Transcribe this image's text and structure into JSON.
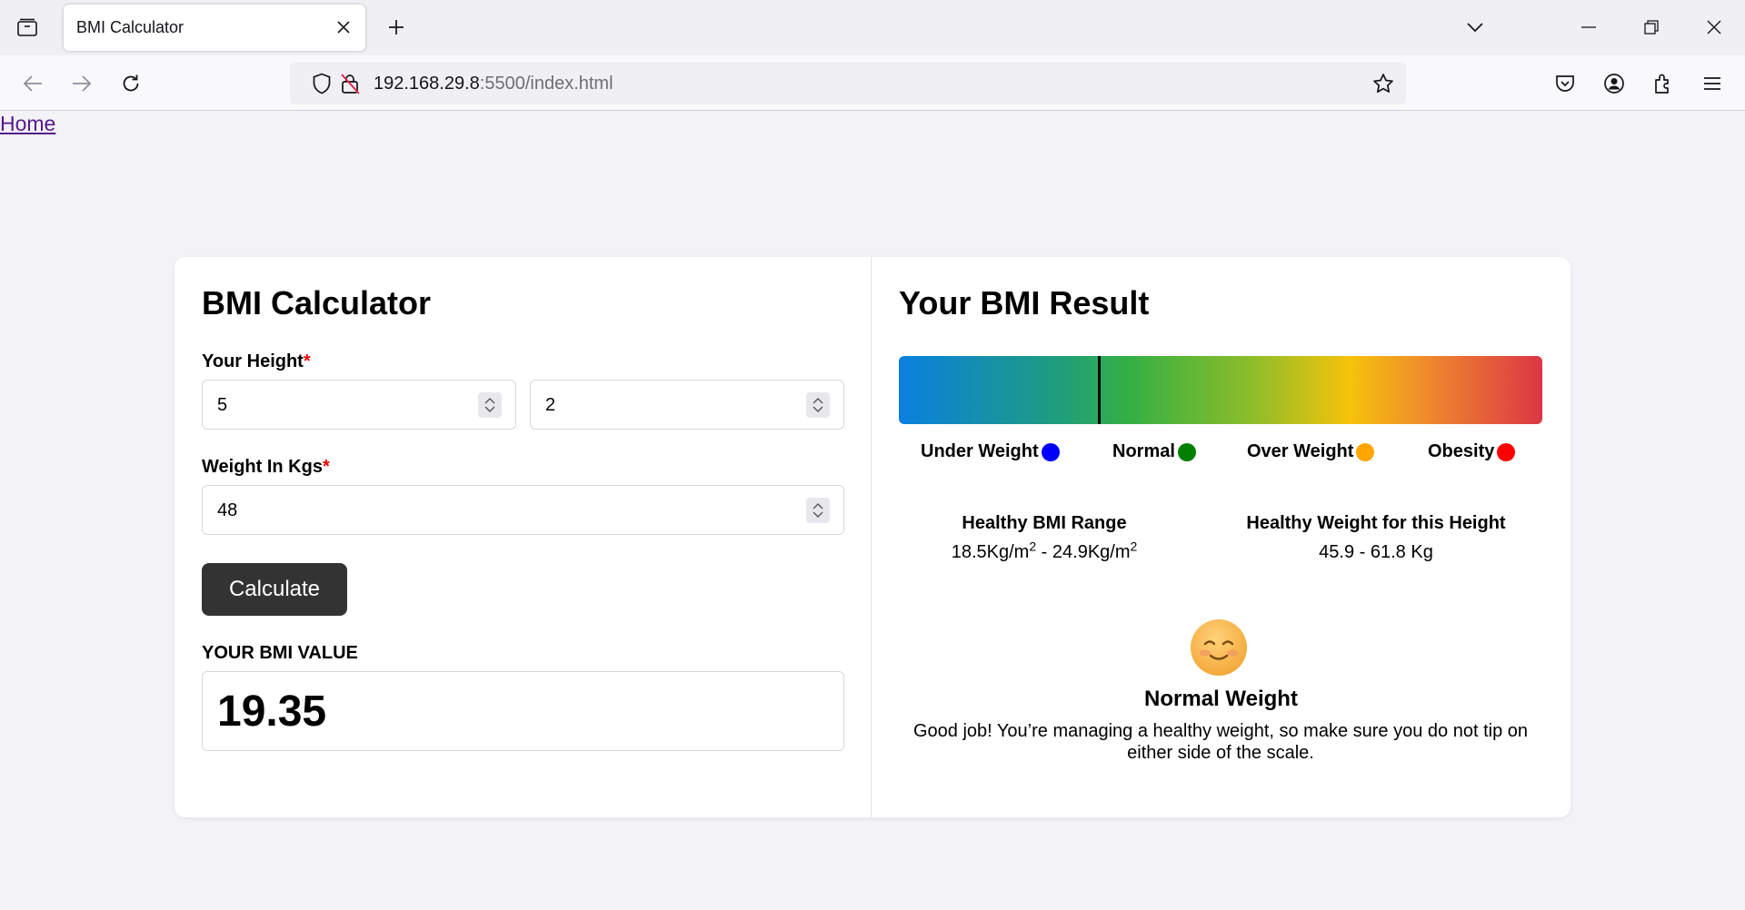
{
  "browser": {
    "tab_title": "BMI Calculator",
    "url_host": "192.168.29.8",
    "url_rest": ":5500/index.html"
  },
  "page": {
    "home_link": "Home"
  },
  "calculator": {
    "title": "BMI Calculator",
    "height_label": "Your Height",
    "required_mark": "*",
    "height_feet": "5",
    "height_inches": "2",
    "weight_label": "Weight In Kgs",
    "weight_value": "48",
    "calculate_button": "Calculate",
    "bmi_value_label": "YOUR BMI VALUE",
    "bmi_value": "19.35"
  },
  "result": {
    "title": "Your BMI Result",
    "scale_marker_fraction": 0.31,
    "legend": [
      {
        "label": "Under Weight",
        "color": "#0000ff"
      },
      {
        "label": "Normal",
        "color": "#008000"
      },
      {
        "label": "Over Weight",
        "color": "#ffa500"
      },
      {
        "label": "Obesity",
        "color": "#ff0000"
      }
    ],
    "healthy_range_title": "Healthy BMI Range",
    "healthy_range_low": "18.5Kg/m",
    "healthy_range_sep": " - ",
    "healthy_range_high": "24.9Kg/m",
    "exponent": "2",
    "healthy_weight_title": "Healthy Weight for this Height",
    "healthy_weight_value": "45.9 - 61.8 Kg",
    "status_emoji": "smiling-face-icon",
    "status_title": "Normal Weight",
    "status_message": "Good job! You’re managing a healthy weight, so make sure you do not tip on either side of the scale."
  }
}
